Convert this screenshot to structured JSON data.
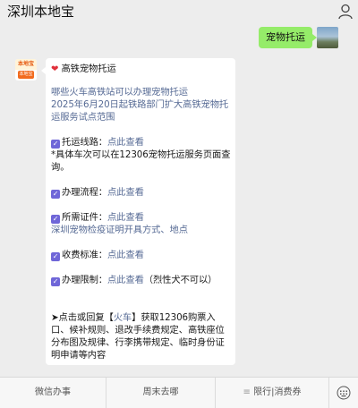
{
  "header": {
    "title": "深圳本地宝"
  },
  "outgoing_message": {
    "text": "宠物托运"
  },
  "incoming_avatar": {
    "logo_top": "本地宝",
    "logo_bottom": "本地宝"
  },
  "article": {
    "heading": "高铁宠物托运",
    "heading_icon": "heart",
    "links": [
      "哪些火车高铁站可以办理宠物托运",
      "2025年6月20日起铁路部门扩大高铁宠物托",
      "运服务试点范围"
    ],
    "items": [
      {
        "label": "托运线路：",
        "link": "点此查看"
      },
      {
        "label": "办理流程：",
        "link": "点此查看"
      },
      {
        "label": "所需证件：",
        "link": "点此查看"
      },
      {
        "label": "收费标准：",
        "link": "点此查看"
      },
      {
        "label": "办理限制：",
        "link": "点此查看",
        "suffix": "（烈性犬不可以）"
      }
    ],
    "route_note_1": "*具体车次可以在12306宠物托运服务页面查",
    "route_note_2": "询。",
    "docs_link": "深圳宠物检疫证明开具方式、地点",
    "footer_lines": [
      "➤点击或回复【",
      "火车",
      "】获取12306购票入",
      "口、候补规则、退改手续费规定、高铁座位",
      "分布图及规律、行李携带规定、临时身份证",
      "明申请等内容"
    ]
  },
  "bottom_bar": {
    "tabs": [
      "微信办事",
      "周末去哪",
      "限行|消费券"
    ]
  },
  "colors": {
    "bubble_green": "#95ec69",
    "link_blue": "#576b95",
    "checkbox_purple": "#6f66d8",
    "heart_red": "#e0303a"
  }
}
